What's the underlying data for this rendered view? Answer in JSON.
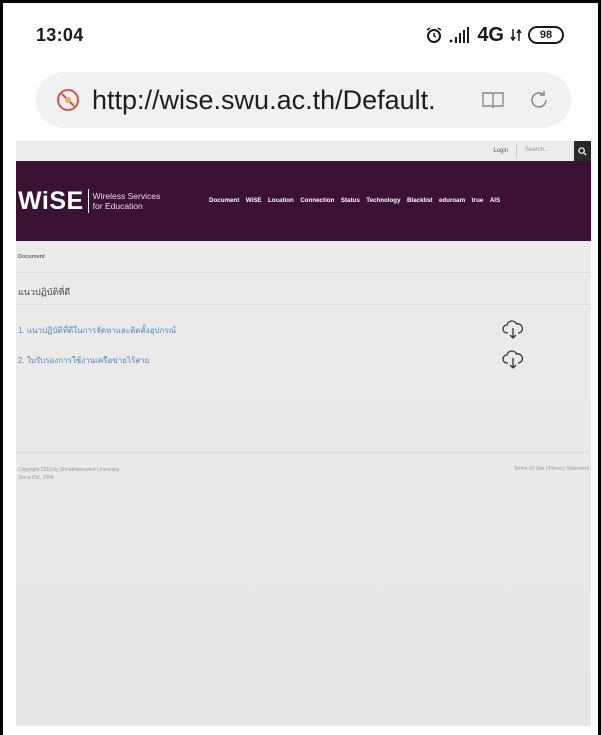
{
  "status_bar": {
    "time": "13:04",
    "network": "4G",
    "battery": "98"
  },
  "browser": {
    "url": "http://wise.swu.ac.th/Default."
  },
  "site": {
    "top": {
      "login": "Login",
      "search_placeholder": "Search..."
    },
    "logo": {
      "name": "WiSE",
      "tagline_1": "Wireless Services",
      "tagline_2": "for Education"
    },
    "nav": [
      "Document",
      "WiSE",
      "Location",
      "Connection",
      "Status",
      "Technology",
      "Blacklist",
      "eduroam",
      "true",
      "AIS"
    ],
    "breadcrumb": "Document",
    "section_title": "แนวปฏิบัติที่ดี",
    "documents": [
      {
        "label": "1. แนวปฏิบัติที่ดีในการจัดหาและติดตั้งอุปกรณ์"
      },
      {
        "label": "2. ใบรับรองการใช้งานเครือข่ายไร้สาย"
      }
    ],
    "footer": {
      "copyright": "Copyright 2019 by Srinakharinwirot University",
      "since": "Since Oct, 2004",
      "links": "Terms Of Use | Privacy Statement"
    }
  }
}
